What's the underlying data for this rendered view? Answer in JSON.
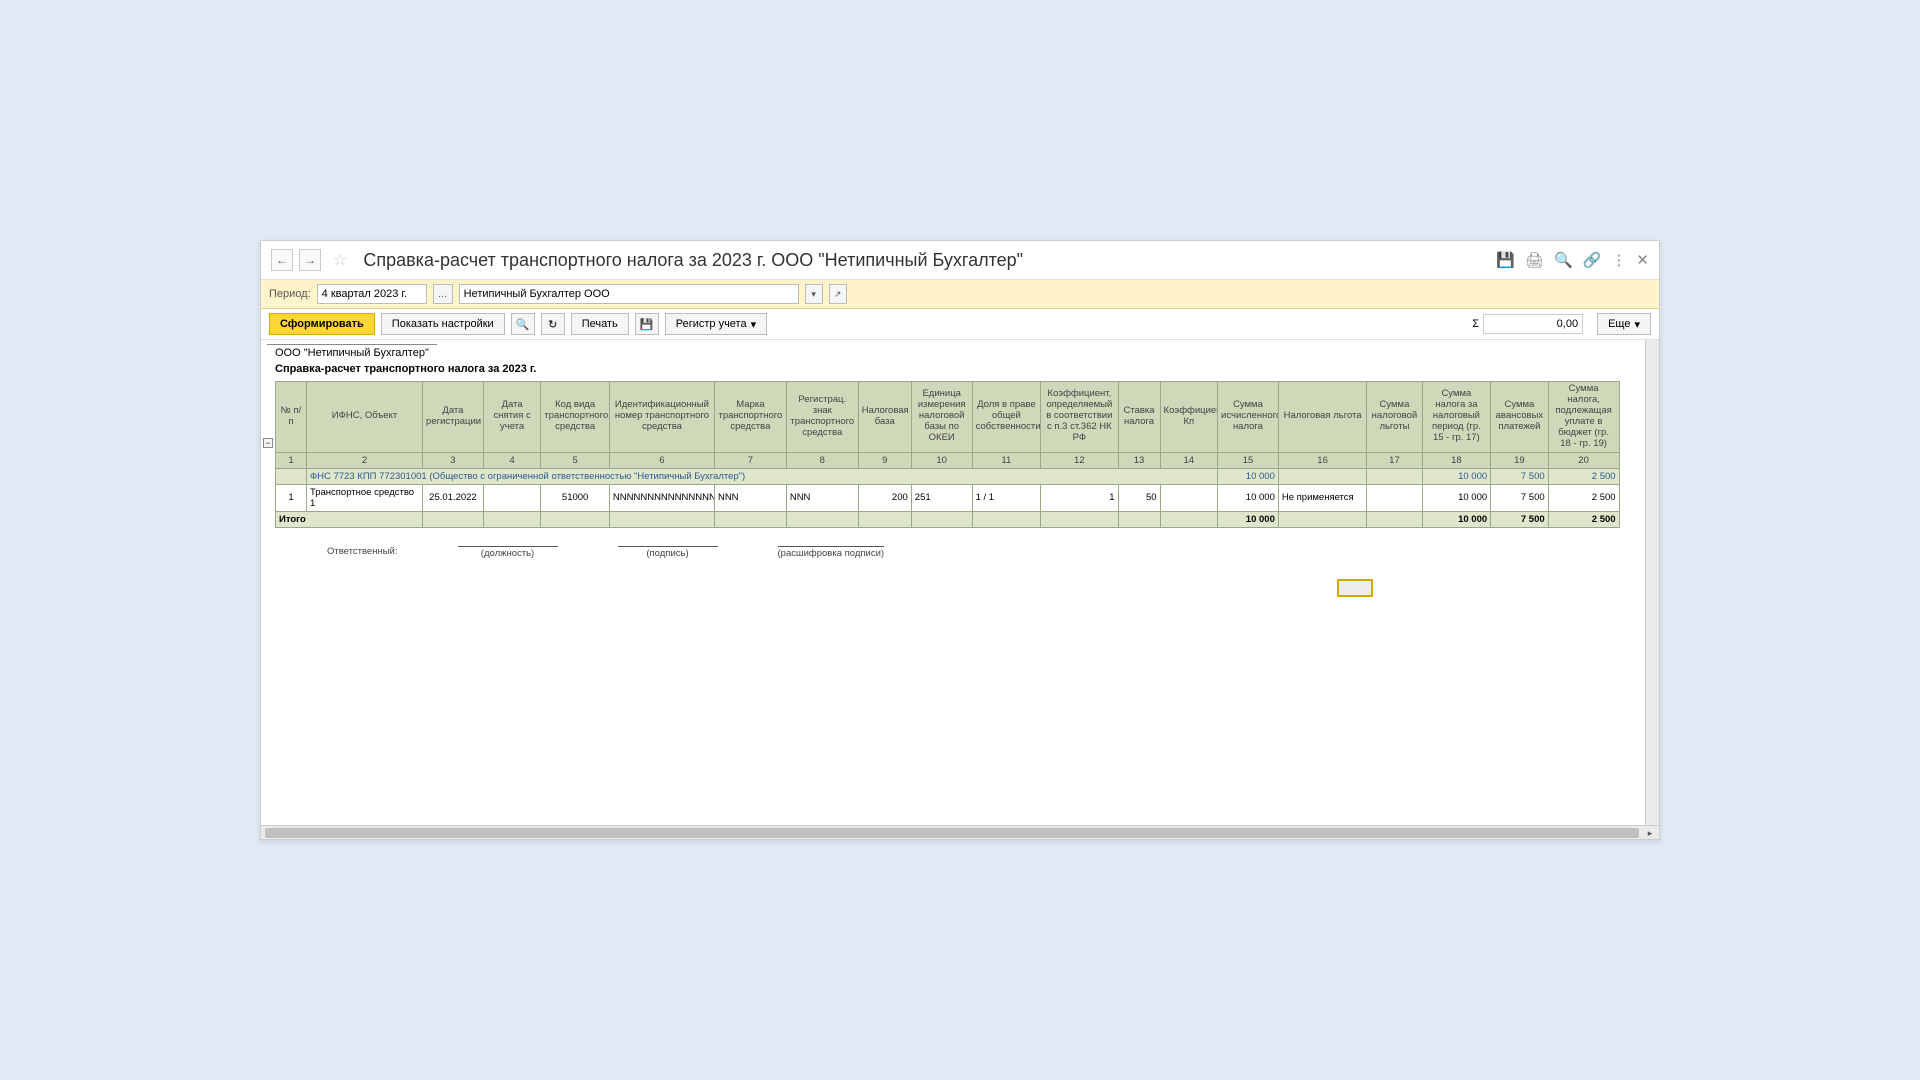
{
  "titlebar": {
    "title": "Справка-расчет транспортного налога за 2023 г. ООО \"Нетипичный Бухгалтер\""
  },
  "period_bar": {
    "label": "Период:",
    "period_value": "4 квартал 2023 г.",
    "org_value": "Нетипичный Бухгалтер ООО"
  },
  "toolbar": {
    "form_btn": "Сформировать",
    "settings_btn": "Показать настройки",
    "print_btn": "Печать",
    "register_btn": "Регистр учета ",
    "sum_sign": "Σ",
    "sum_value": "0,00",
    "more_btn": "Еще "
  },
  "report": {
    "org_line": "ООО \"Нетипичный Бухгалтер\"",
    "title": "Справка-расчет транспортного налога за 2023 г."
  },
  "headers": [
    "№ п/п",
    "ИФНС, Объект",
    "Дата регистрации",
    "Дата снятия с учета",
    "Код вида транспортного средства",
    "Идентификационный номер транспортного средства",
    "Марка транспортного средства",
    "Регистрац. знак транспортного средства",
    "Налоговая база",
    "Единица измерения налоговой базы по ОКЕИ",
    "Доля в праве общей собственности",
    "Коэффициент, определяемый в соответствии с п.3 ст.362 НК РФ",
    "Ставка налога",
    "Коэффициент Кп",
    "Сумма исчисленного налога",
    "Налоговая льгота",
    "Сумма налоговой льготы",
    "Сумма налога за налоговый период (гр. 15 - гр. 17)",
    "Сумма авансовых платежей",
    "Сумма налога, подлежащая уплате в бюджет (гр. 18 - гр. 19)"
  ],
  "num_row": [
    "1",
    "2",
    "3",
    "4",
    "5",
    "6",
    "7",
    "8",
    "9",
    "10",
    "11",
    "12",
    "13",
    "14",
    "15",
    "16",
    "17",
    "18",
    "19",
    "20"
  ],
  "group_row": {
    "text": "ФНС 7723 КПП 772301001 (Общество с ограниченной ответственностью \"Нетипичный Бухгалтер\")",
    "c15": "10 000",
    "c18": "10 000",
    "c19": "7 500",
    "c20": "2 500"
  },
  "data_row": {
    "c1": "1",
    "c2": "Транспортное средство 1",
    "c3": "25.01.2022",
    "c4": "",
    "c5": "51000",
    "c6": "NNNNNNNNNNNNNNNN",
    "c7": "NNN",
    "c8": "NNN",
    "c9": "200",
    "c10": "251",
    "c11": "1 / 1",
    "c12": "1",
    "c13": "50",
    "c14": "",
    "c15": "10 000",
    "c16": "Не применяется",
    "c17": "",
    "c18": "10 000",
    "c19": "7 500",
    "c20": "2 500"
  },
  "total_row": {
    "label": "Итого",
    "c15": "10 000",
    "c18": "10 000",
    "c19": "7 500",
    "c20": "2 500"
  },
  "signatures": {
    "resp": "Ответственный:",
    "pos": "(должность)",
    "sign": "(подпись)",
    "decode": "(расшифровка подписи)"
  }
}
